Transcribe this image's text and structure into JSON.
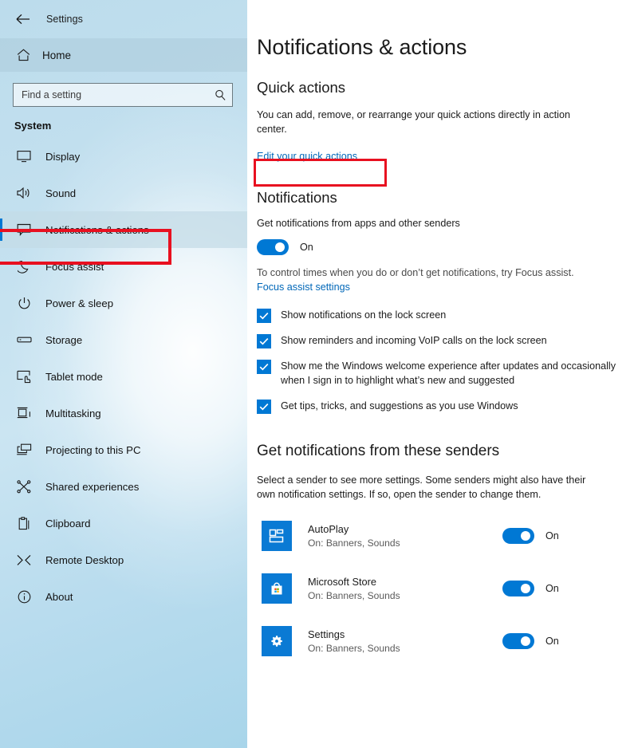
{
  "window": {
    "back_icon": "back-arrow-icon",
    "title": "Settings"
  },
  "sidebar": {
    "home": {
      "label": "Home",
      "icon": "home-icon"
    },
    "search": {
      "placeholder": "Find a setting",
      "value": "",
      "icon": "search-icon"
    },
    "group_title": "System",
    "items": [
      {
        "label": "Display",
        "icon": "monitor-icon",
        "selected": false
      },
      {
        "label": "Sound",
        "icon": "speaker-icon",
        "selected": false
      },
      {
        "label": "Notifications & actions",
        "icon": "notification-balloon-icon",
        "selected": true
      },
      {
        "label": "Focus assist",
        "icon": "moon-icon",
        "selected": false
      },
      {
        "label": "Power & sleep",
        "icon": "power-icon",
        "selected": false
      },
      {
        "label": "Storage",
        "icon": "drive-icon",
        "selected": false
      },
      {
        "label": "Tablet mode",
        "icon": "tablet-touch-icon",
        "selected": false
      },
      {
        "label": "Multitasking",
        "icon": "multitasking-icon",
        "selected": false
      },
      {
        "label": "Projecting to this PC",
        "icon": "projecting-icon",
        "selected": false
      },
      {
        "label": "Shared experiences",
        "icon": "share-nodes-icon",
        "selected": false
      },
      {
        "label": "Clipboard",
        "icon": "clipboard-icon",
        "selected": false
      },
      {
        "label": "Remote Desktop",
        "icon": "remote-desktop-icon",
        "selected": false
      },
      {
        "label": "About",
        "icon": "info-circle-icon",
        "selected": false
      }
    ]
  },
  "main": {
    "page_title": "Notifications & actions",
    "quick_actions": {
      "heading": "Quick actions",
      "description": "You can add, remove, or rearrange your quick actions directly in action center.",
      "link": "Edit your quick actions"
    },
    "notifications": {
      "heading": "Notifications",
      "toggle_label": "Get notifications from apps and other senders",
      "toggle_state": "On",
      "hint": "To control times when you do or don’t get notifications, try Focus assist.",
      "hint_link": "Focus assist settings",
      "checkboxes": [
        {
          "label": "Show notifications on the lock screen",
          "checked": true
        },
        {
          "label": "Show reminders and incoming VoIP calls on the lock screen",
          "checked": true
        },
        {
          "label": "Show me the Windows welcome experience after updates and occasionally when I sign in to highlight what’s new and suggested",
          "checked": true
        },
        {
          "label": "Get tips, tricks, and suggestions as you use Windows",
          "checked": true
        }
      ]
    },
    "senders": {
      "heading": "Get notifications from these senders",
      "description": "Select a sender to see more settings. Some senders might also have their own notification settings. If so, open the sender to change them.",
      "items": [
        {
          "name": "AutoPlay",
          "status": "On: Banners, Sounds",
          "toggle_state": "On",
          "icon": "autoplay-tile-icon"
        },
        {
          "name": "Microsoft Store",
          "status": "On: Banners, Sounds",
          "toggle_state": "On",
          "icon": "microsoft-store-icon"
        },
        {
          "name": "Settings",
          "status": "On: Banners, Sounds",
          "toggle_state": "On",
          "icon": "gear-icon"
        }
      ]
    }
  },
  "annotations": {
    "accent_color": "#e81020",
    "link_color": "#0067b8",
    "toggle_color": "#0078d4"
  }
}
